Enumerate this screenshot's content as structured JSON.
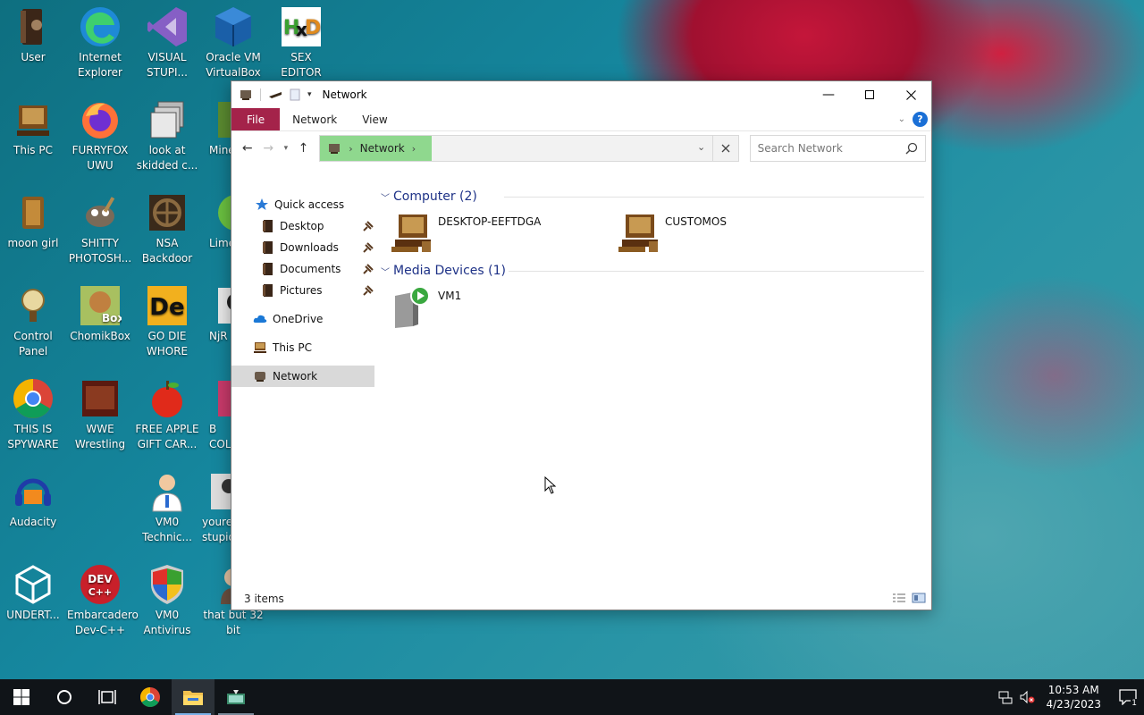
{
  "desktop": {
    "icons": [
      {
        "label": "User",
        "icon": "user-folder-icon"
      },
      {
        "label": "Internet\nExplorer",
        "icon": "edge-icon"
      },
      {
        "label": "VISUAL\nSTUPI...",
        "icon": "visual-studio-icon"
      },
      {
        "label": "Oracle VM\nVirtualBox",
        "icon": "virtualbox-icon"
      },
      {
        "label": "SEX\nEDITOR",
        "icon": "hex-editor-icon"
      },
      {
        "label": "This PC",
        "icon": "this-pc-icon"
      },
      {
        "label": "FURRYFOX\nUWU",
        "icon": "firefox-icon"
      },
      {
        "label": "look at\nskidded c...",
        "icon": "copy-files-icon"
      },
      {
        "label": "Mine",
        "icon": "minecraft-icon"
      },
      {
        "label": "moon girl",
        "icon": "moon-girl-icon"
      },
      {
        "label": "SHITTY\nPHOTOSH...",
        "icon": "gimp-icon"
      },
      {
        "label": "NSA\nBackdoor",
        "icon": "nsa-backdoor-icon"
      },
      {
        "label": "Lime",
        "icon": "lime-icon"
      },
      {
        "label": "Control\nPanel",
        "icon": "control-panel-icon"
      },
      {
        "label": "ChomikBox",
        "icon": "chomikbox-icon"
      },
      {
        "label": "GO DIE\nWHORE",
        "icon": "de-app-icon"
      },
      {
        "label": "NjR",
        "icon": "njrat-icon"
      },
      {
        "label": "THIS IS\nSPYWARE",
        "icon": "chrome-icon"
      },
      {
        "label": "WWE\nWrestling",
        "icon": "wwe-icon"
      },
      {
        "label": "FREE APPLE\nGIFT CAR...",
        "icon": "apple-icon"
      },
      {
        "label": "B\nCOLL",
        "icon": "collection-icon"
      },
      {
        "label": "Audacity",
        "icon": "audacity-icon"
      },
      {
        "label": "VM0\nTechnic...",
        "icon": "technician-icon"
      },
      {
        "label": "youre\nstupid",
        "icon": "youre-stupid-icon"
      },
      {
        "label": "UNDERT...",
        "icon": "unity-icon"
      },
      {
        "label": "Embarcadero\nDev-C++",
        "icon": "devcpp-icon"
      },
      {
        "label": "VM0\nAntivirus",
        "icon": "antivirus-shield-icon"
      },
      {
        "label": "that but 32\nbit",
        "icon": "portrait-icon"
      }
    ]
  },
  "window": {
    "title": "Network",
    "ribbon_tabs": {
      "file": "File",
      "network": "Network",
      "view": "View"
    },
    "address": {
      "crumb": "Network"
    },
    "search": {
      "placeholder": "Search Network"
    },
    "nav": {
      "quick_access": "Quick access",
      "desktop": "Desktop",
      "downloads": "Downloads",
      "documents": "Documents",
      "pictures": "Pictures",
      "onedrive": "OneDrive",
      "this_pc": "This PC",
      "network": "Network"
    },
    "groups": {
      "computer": {
        "header": "Computer (2)",
        "items": [
          "DESKTOP-EEFTDGA",
          "CUSTOMOS"
        ]
      },
      "media": {
        "header": "Media Devices (1)",
        "items": [
          "VM1"
        ]
      }
    },
    "status": "3 items"
  },
  "taskbar": {
    "time": "10:53 AM",
    "date": "4/23/2023",
    "notif_count": "1"
  },
  "colors": {
    "file_tab": "#a4234a",
    "breadcrumb": "#8fd88e",
    "group_header": "#1e3287",
    "taskbar": "#101418"
  }
}
